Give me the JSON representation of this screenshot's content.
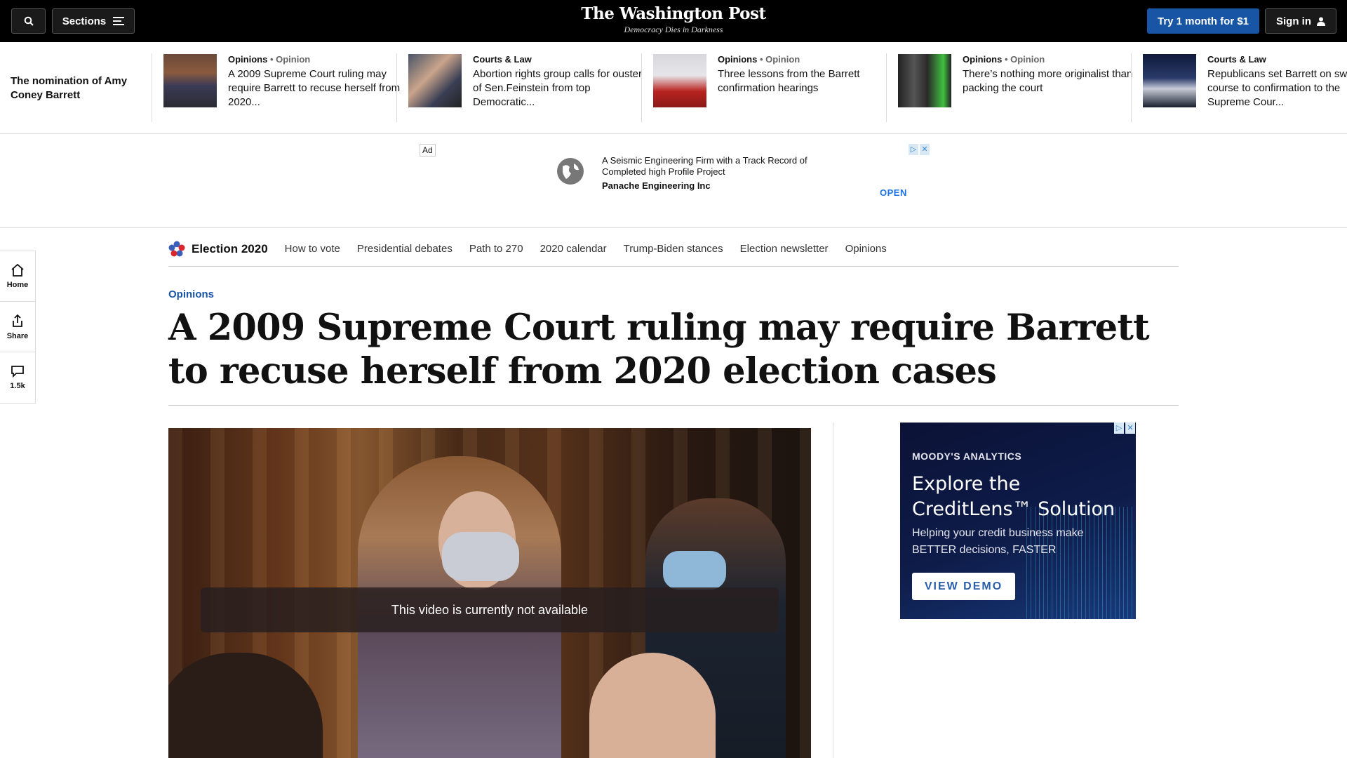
{
  "header": {
    "sections_label": "Sections",
    "logo": "The Washington Post",
    "tagline": "Democracy Dies in Darkness",
    "try_label": "Try 1 month for $1",
    "signin_label": "Sign in"
  },
  "strip": {
    "title": "The nomination of Amy Coney Barrett",
    "items": [
      {
        "kicker": "Opinions",
        "sub": "• Opinion",
        "headline": "A 2009 Supreme Court ruling may require Barrett to recuse herself from 2020..."
      },
      {
        "kicker": "Courts & Law",
        "sub": "",
        "headline": "Abortion rights group calls for ouster of Sen.Feinstein from top Democratic..."
      },
      {
        "kicker": "Opinions",
        "sub": "• Opinion",
        "headline": "Three lessons from the Barrett confirmation hearings"
      },
      {
        "kicker": "Opinions",
        "sub": "• Opinion",
        "headline": "There’s nothing more originalist than packing the court"
      },
      {
        "kicker": "Courts & Law",
        "sub": "",
        "headline": "Republicans set Barrett on swift course to confirmation to the Supreme Cour..."
      }
    ]
  },
  "ad": {
    "label": "Ad",
    "copy": "A Seismic Engineering Firm with a Track Record of Completed high Profile Project",
    "brand": "Panache Engineering Inc",
    "cta": "OPEN"
  },
  "rail": {
    "home": "Home",
    "share": "Share",
    "comments": "1.5k"
  },
  "elecnav": {
    "title": "Election 2020",
    "links": [
      "How to vote",
      "Presidential debates",
      "Path to 270",
      "2020 calendar",
      "Trump-Biden stances",
      "Election newsletter",
      "Opinions"
    ]
  },
  "article": {
    "kicker": "Opinions",
    "headline": "A 2009 Supreme Court ruling may require Barrett to recuse herself from 2020 election cases",
    "video_message": "This video is currently not available"
  },
  "side_ad": {
    "brand": "MOODY'S ANALYTICS",
    "headline": "Explore the CreditLens™ Solution",
    "sub": "Helping your credit business make BETTER decisions, FASTER",
    "cta": "VIEW DEMO"
  },
  "colors": {
    "brand_blue": "#1955a5",
    "topbar": "#000000"
  }
}
